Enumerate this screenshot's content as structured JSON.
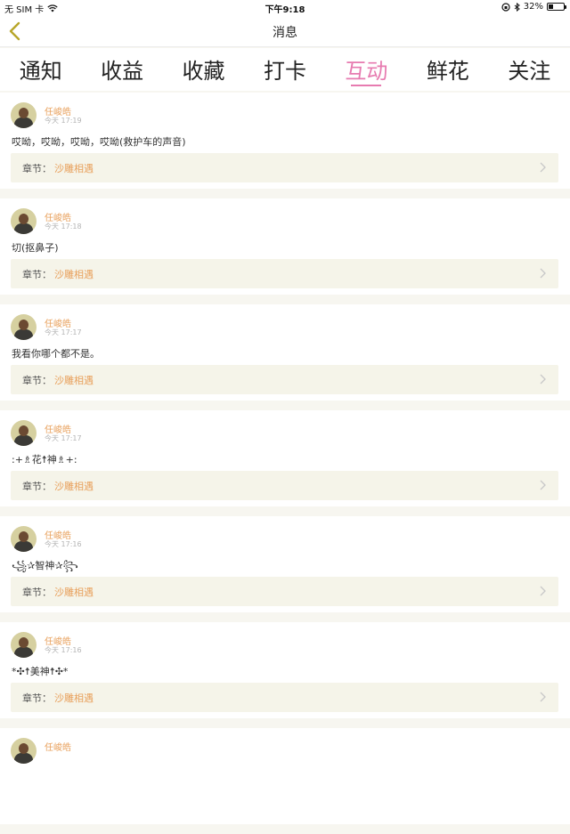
{
  "status_bar": {
    "carrier": "无 SIM 卡",
    "time": "下午9:18",
    "battery": "32%",
    "battery_level": 0.32
  },
  "nav": {
    "title": "消息"
  },
  "tabs": [
    {
      "label": "通知",
      "active": false
    },
    {
      "label": "收益",
      "active": false
    },
    {
      "label": "收藏",
      "active": false
    },
    {
      "label": "打卡",
      "active": false
    },
    {
      "label": "互动",
      "active": true
    },
    {
      "label": "鲜花",
      "active": false
    },
    {
      "label": "关注",
      "active": false
    }
  ],
  "chapter_label": "章节：",
  "messages": [
    {
      "user": "任峻皓",
      "time": "今天 17:19",
      "text": "哎呦，哎呦，哎呦，哎呦(救护车的声音)",
      "chapter": "沙雕相遇"
    },
    {
      "user": "任峻皓",
      "time": "今天 17:18",
      "text": "切(抠鼻子)",
      "chapter": "沙雕相遇"
    },
    {
      "user": "任峻皓",
      "time": "今天 17:17",
      "text": "我看你哪个都不是。",
      "chapter": "沙雕相遇"
    },
    {
      "user": "任峻皓",
      "time": "今天 17:17",
      "text": ":+♗花☨神♗+:",
      "chapter": "沙雕相遇"
    },
    {
      "user": "任峻皓",
      "time": "今天 17:16",
      "text": "꧁✰智神✰꧂",
      "chapter": "沙雕相遇"
    },
    {
      "user": "任峻皓",
      "time": "今天 17:16",
      "text": "*✣☨美神☨✣*",
      "chapter": "沙雕相遇"
    },
    {
      "user": "任峻皓",
      "time": "",
      "text": "",
      "chapter": ""
    }
  ]
}
